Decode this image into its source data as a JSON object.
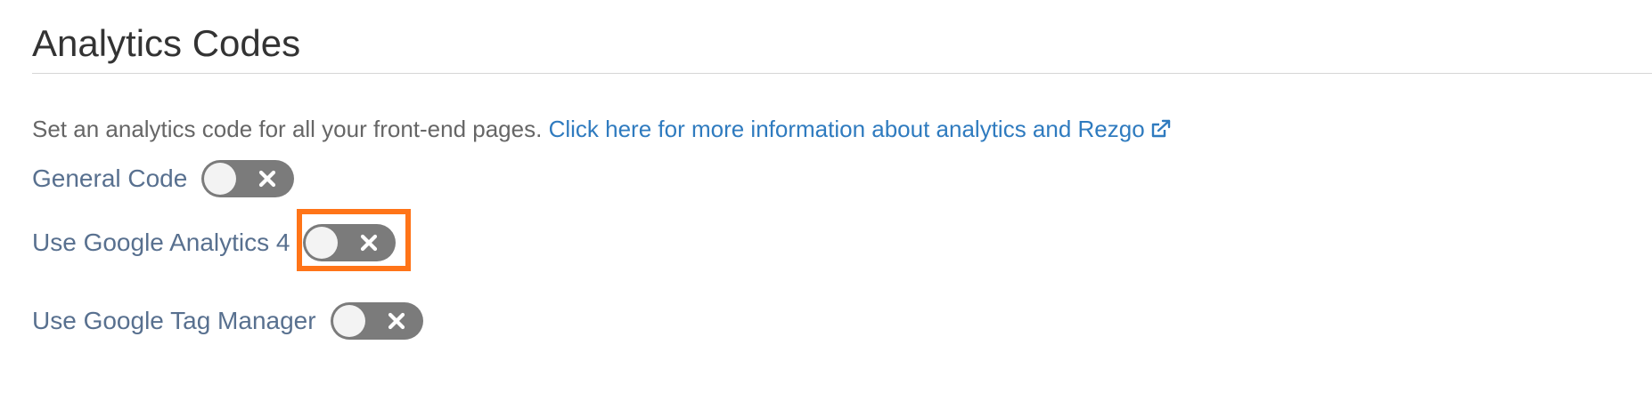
{
  "section": {
    "title": "Analytics Codes"
  },
  "intro": {
    "text": "Set an analytics code for all your front-end pages.",
    "link_text": "Click here for more information about analytics and Rezgo",
    "link_icon": "external-link-icon"
  },
  "settings": [
    {
      "label": "General Code",
      "enabled": false,
      "toggle_icon": "close-icon"
    },
    {
      "label": "Use Google Analytics 4",
      "enabled": false,
      "toggle_icon": "close-icon",
      "highlighted": true
    },
    {
      "label": "Use Google Tag Manager",
      "enabled": false,
      "toggle_icon": "close-icon"
    }
  ],
  "colors": {
    "link": "#2f7bbf",
    "label": "#58708f",
    "toggle_off": "#7b7b7b",
    "highlight": "#ff7418"
  }
}
